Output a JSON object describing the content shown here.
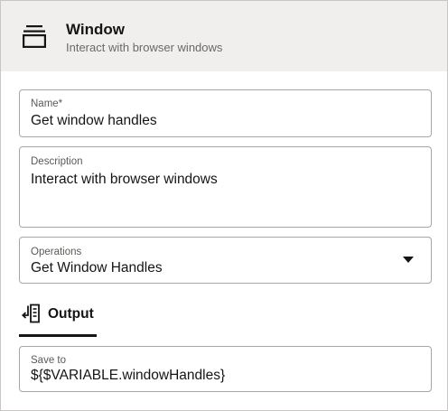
{
  "header": {
    "icon": "window-stack-icon",
    "title": "Window",
    "subtitle": "Interact with browser windows"
  },
  "form": {
    "name": {
      "label": "Name*",
      "value": "Get window handles"
    },
    "description": {
      "label": "Description",
      "value": "Interact with browser windows"
    },
    "operations": {
      "label": "Operations",
      "value": "Get Window Handles",
      "icon": "chevron-down-icon"
    }
  },
  "tabs": [
    {
      "label": "Output",
      "icon": "output-icon",
      "active": true
    }
  ],
  "output": {
    "save_to": {
      "label": "Save to",
      "value": "${$VARIABLE.windowHandles}"
    }
  }
}
